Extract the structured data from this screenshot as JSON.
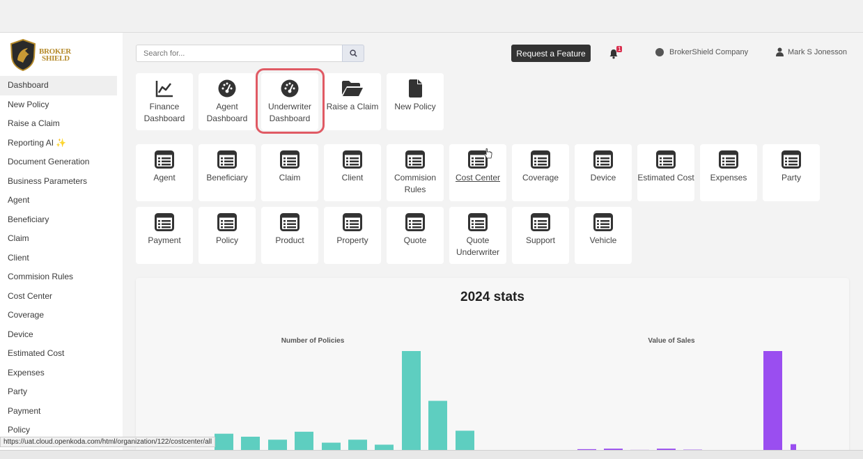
{
  "brand": {
    "line1": "BROKER",
    "line2": "SHIELD"
  },
  "sidebar": {
    "items": [
      {
        "label": "Dashboard"
      },
      {
        "label": "New Policy"
      },
      {
        "label": "Raise a Claim"
      },
      {
        "label": "Reporting AI ✨"
      },
      {
        "label": "Document Generation"
      },
      {
        "label": "Business Parameters"
      },
      {
        "label": "Agent"
      },
      {
        "label": "Beneficiary"
      },
      {
        "label": "Claim"
      },
      {
        "label": "Client"
      },
      {
        "label": "Commision Rules"
      },
      {
        "label": "Cost Center"
      },
      {
        "label": "Coverage"
      },
      {
        "label": "Device"
      },
      {
        "label": "Estimated Cost"
      },
      {
        "label": "Expenses"
      },
      {
        "label": "Party"
      },
      {
        "label": "Payment"
      },
      {
        "label": "Policy"
      }
    ]
  },
  "header": {
    "search_placeholder": "Search for...",
    "request_feature": "Request a Feature",
    "notification_count": "1",
    "company": "BrokerShield Company",
    "user": "Mark S Jonesson"
  },
  "dashboards": [
    {
      "label": "Finance Dashboard",
      "icon": "chart-line-icon"
    },
    {
      "label": "Agent Dashboard",
      "icon": "gauge-icon"
    },
    {
      "label": "Underwriter Dashboard",
      "icon": "gauge-icon"
    },
    {
      "label": "Raise a Claim",
      "icon": "folder-open-icon"
    },
    {
      "label": "New Policy",
      "icon": "file-icon"
    }
  ],
  "entities": [
    {
      "label": "Agent"
    },
    {
      "label": "Beneficiary"
    },
    {
      "label": "Claim"
    },
    {
      "label": "Client"
    },
    {
      "label": "Commision Rules"
    },
    {
      "label": "Cost Center"
    },
    {
      "label": "Coverage"
    },
    {
      "label": "Device"
    },
    {
      "label": "Estimated Cost"
    },
    {
      "label": "Expenses"
    },
    {
      "label": "Party"
    },
    {
      "label": "Payment"
    },
    {
      "label": "Policy"
    },
    {
      "label": "Product"
    },
    {
      "label": "Property"
    },
    {
      "label": "Quote"
    },
    {
      "label": "Quote Underwriter"
    },
    {
      "label": "Support"
    },
    {
      "label": "Vehicle"
    }
  ],
  "stats": {
    "title": "2024 stats"
  },
  "chart_data": [
    {
      "type": "bar",
      "title": "Number of Policies",
      "color": "#5ecec0",
      "values": [
        17,
        14,
        11,
        19,
        8,
        11,
        6,
        100,
        50,
        20
      ],
      "ylim": [
        0,
        100
      ]
    },
    {
      "type": "bar",
      "title": "Value of Sales",
      "color": "#9a4ef0",
      "values": [
        0.5,
        0.3,
        1.5,
        2,
        0.8,
        2,
        1,
        0.5,
        0.3,
        100,
        6.5,
        0.5
      ],
      "ylim": [
        0,
        100
      ]
    }
  ],
  "status_url": "https://uat.cloud.openkoda.com/html/organization/122/costcenter/all",
  "colors": {
    "accent": "#5ecec0",
    "purple": "#9a4ef0",
    "highlight": "#e05a64",
    "dark_button": "#333333"
  }
}
